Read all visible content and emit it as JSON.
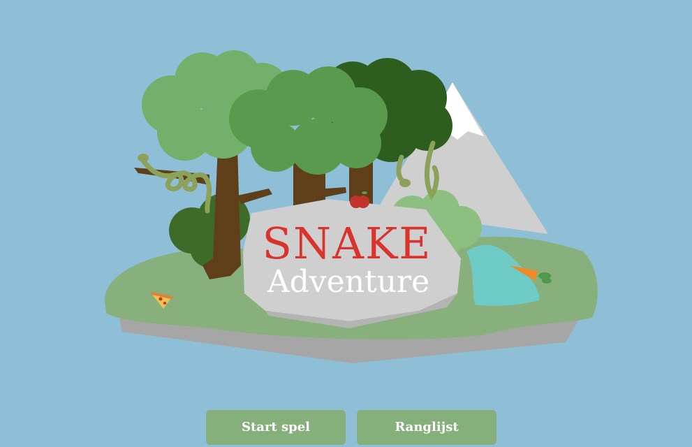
{
  "title": {
    "line1": "SNAKE",
    "line2": "Adventure"
  },
  "buttons": {
    "start": "Start spel",
    "leaderboard": "Ranglijst"
  },
  "colors": {
    "background": "#8fbfd6",
    "title_red": "#d8332c",
    "button": "#85b07b",
    "grass": "#87b07d",
    "rock": "#cfcfcf"
  },
  "scene_items": [
    "island",
    "mountain",
    "trees",
    "snakes",
    "apple-icon",
    "pizza-icon",
    "carrot-icon",
    "waterfall"
  ]
}
